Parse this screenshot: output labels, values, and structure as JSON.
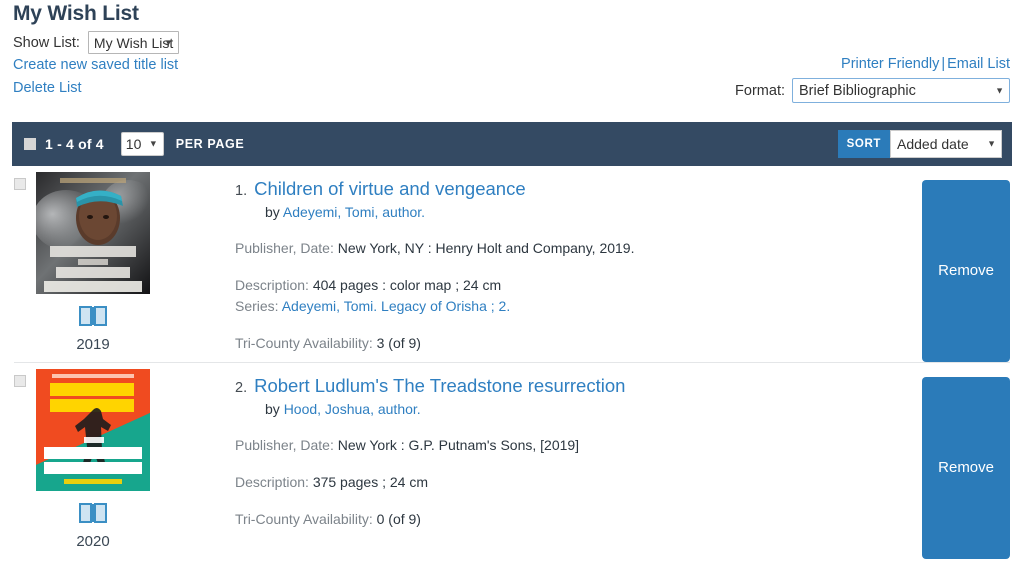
{
  "header": {
    "title": "My Wish List",
    "show_list_label": "Show List:",
    "show_list_value": "My Wish List",
    "create_link": "Create new saved title list",
    "delete_link": "Delete List",
    "printer_friendly_link": "Printer Friendly",
    "link_separator": "|",
    "email_list_link": "Email List",
    "format_label": "Format:",
    "format_value": "Brief Bibliographic"
  },
  "toolbar": {
    "count_text": "1 - 4 of 4",
    "per_page_value": "10",
    "per_page_label": "PER PAGE",
    "sort_badge": "SORT",
    "sort_value": "Added date",
    "background_color": "#344a63",
    "sort_badge_color": "#2b7bb9"
  },
  "results": [
    {
      "number": "1.",
      "title": "Children of virtue and vengeance",
      "by_word": "by",
      "author": "Adeyemi, Tomi, author.",
      "publisher_label": "Publisher, Date:",
      "publisher_value": "New York, NY : Henry Holt and Company, 2019.",
      "description_label": "Description:",
      "description_value": "404 pages : color map ; 24 cm",
      "series_label": "Series:",
      "series_value": "Adeyemi, Tomi. Legacy of Orisha ; 2.",
      "availability_label": "Tri-County Availability:",
      "availability_value": "3 (of 9)",
      "year": "2019",
      "format_icon": "open-book-icon",
      "remove_label": "Remove",
      "cover_alt": "Children of virtue and vengeance book cover"
    },
    {
      "number": "2.",
      "title": "Robert Ludlum's The Treadstone resurrection",
      "by_word": "by",
      "author": "Hood, Joshua, author.",
      "publisher_label": "Publisher, Date:",
      "publisher_value": "New York : G.P. Putnam's Sons, [2019]",
      "description_label": "Description:",
      "description_value": "375 pages ; 24 cm",
      "series_label": "",
      "series_value": "",
      "availability_label": "Tri-County Availability:",
      "availability_value": "0 (of 9)",
      "year": "2020",
      "format_icon": "open-book-icon",
      "remove_label": "Remove",
      "cover_alt": "Robert Ludlum's The Treadstone resurrection book cover"
    }
  ],
  "colors": {
    "link": "#2f7fc1",
    "heading": "#2e4257",
    "toolbar": "#344a63",
    "button": "#2b7bb9"
  }
}
